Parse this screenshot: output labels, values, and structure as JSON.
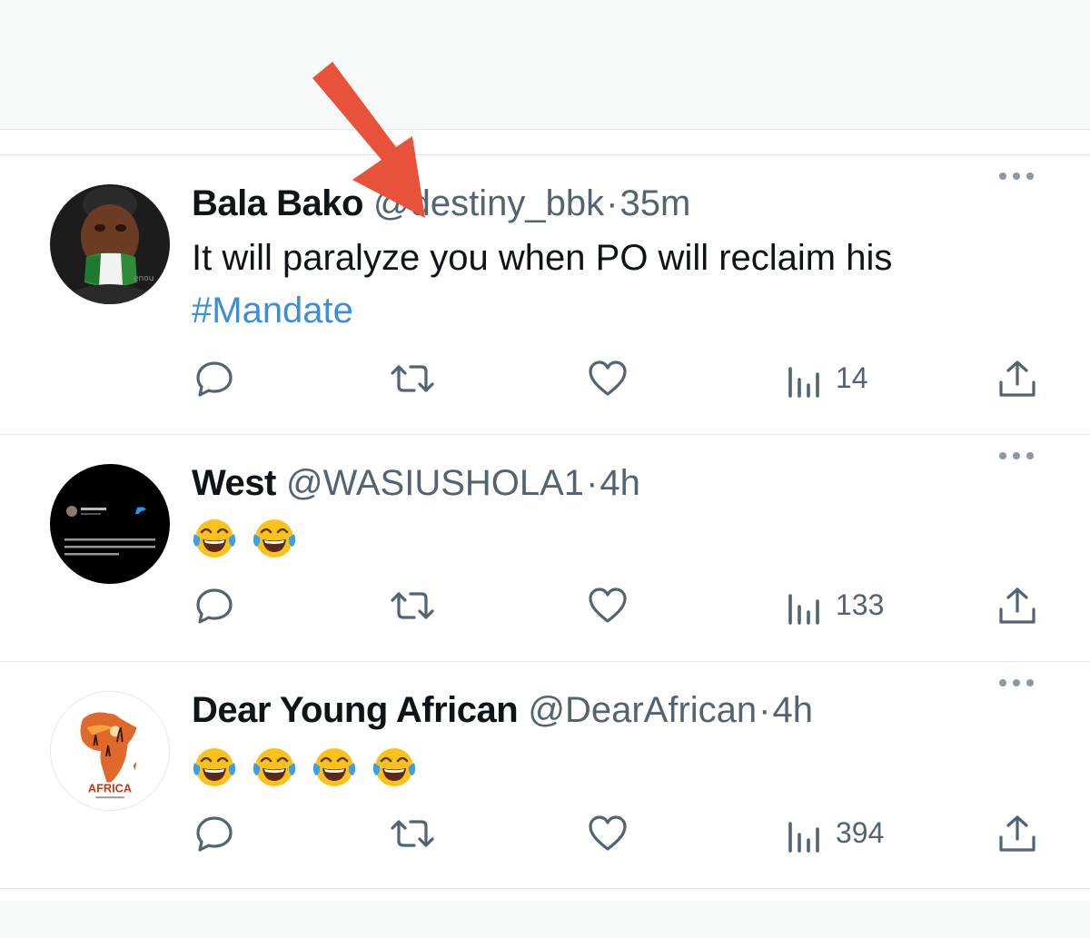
{
  "tweets": [
    {
      "name": "Bala Bako",
      "handle": "@destiny_bbk",
      "separator": "·",
      "time": "35m",
      "text": "It will paralyze you when PO will reclaim his",
      "hashtag": "#Mandate",
      "views": "14",
      "avatar": "woman-with-nigerian-flag-mask-avatar"
    },
    {
      "name": "West",
      "handle": "@WASIUSHOLA1",
      "separator": "·",
      "time": "4h",
      "emoji_count": 2,
      "views": "133",
      "avatar": "dark-quote-card-avatar",
      "avatar_text": "I helped a man climb a mountain and found that I too had reached the top. - Unknown"
    },
    {
      "name": "Dear Young African",
      "handle": "@DearAfrican",
      "separator": "·",
      "time": "4h",
      "emoji_count": 4,
      "views": "394",
      "avatar": "africa-map-logo-avatar",
      "avatar_text": "AFRICA"
    }
  ],
  "icons": {
    "reply": "reply-icon",
    "retweet": "retweet-icon",
    "like": "like-icon",
    "views": "views-icon",
    "share": "share-icon",
    "more": "more-icon",
    "emoji": "face-with-tears-of-joy"
  },
  "colors": {
    "arrow": "#e8513a",
    "hashtag": "#3a8fd8",
    "muted": "#536471"
  }
}
